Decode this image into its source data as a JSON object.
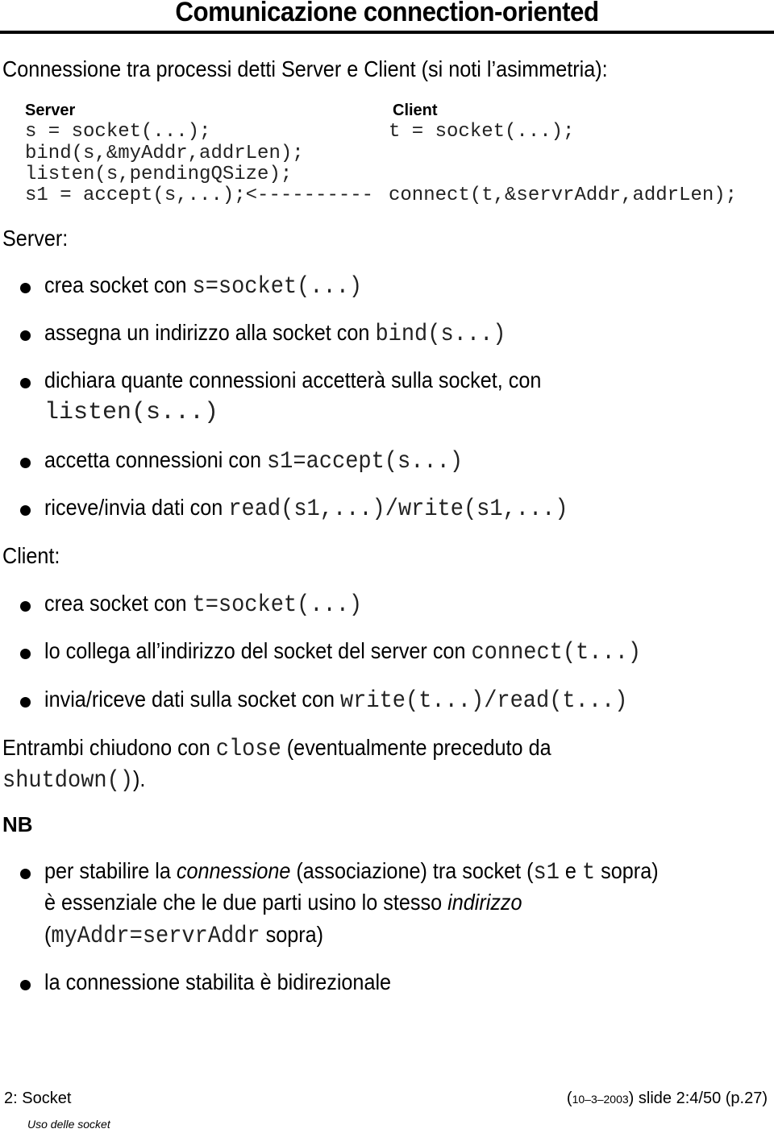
{
  "header": {
    "title": "Comunicazione connection-oriented"
  },
  "intro": "Connessione tra processi detti Server e Client (si noti l’asimmetria):",
  "code_block": {
    "server_heading": "Server",
    "client_heading": "Client",
    "server_lines": [
      "s = socket(...);",
      "bind(s,&myAddr,addrLen);",
      "listen(s,pendingQSize);",
      "s1 = accept(s,...);<----------"
    ],
    "client_lines": [
      "t = socket(...);",
      "",
      "",
      "connect(t,&servrAddr,addrLen);"
    ]
  },
  "server_section": {
    "heading": "Server:",
    "bullets": [
      {
        "text": "crea socket con ",
        "code": "s=socket(...)"
      },
      {
        "text": "assegna un indirizzo alla socket con ",
        "code": "bind(s...)"
      },
      {
        "text": "dichiara quante connessioni accetterà sulla socket, con",
        "code_line2": "listen(s...)"
      },
      {
        "text": "accetta connessioni con ",
        "code": "s1=accept(s...)"
      },
      {
        "text": "riceve/invia dati con ",
        "code": "read(s1,...)/write(s1,...)"
      }
    ]
  },
  "client_section": {
    "heading": "Client:",
    "bullets": [
      {
        "text": "crea socket con ",
        "code": "t=socket(...)"
      },
      {
        "text": "lo collega all’indirizzo del socket del server con ",
        "code": "connect(t...)"
      },
      {
        "text": "invia/riceve dati sulla socket con ",
        "code": "write(t...)/read(t...)"
      }
    ]
  },
  "closing": {
    "prefix": "Entrambi chiudono con ",
    "code": "close",
    "suffix": " (eventualmente preceduto da",
    "line2_code": "shutdown()",
    "line2_suffix": ")."
  },
  "nb": {
    "heading": "NB",
    "bullet1": {
      "l1_a": "per stabilire la ",
      "l1_em": "connessione",
      "l1_b": " (associazione) tra socket (",
      "l1_code1": "s1",
      "l1_c": " e ",
      "l1_code2": "t",
      "l1_d": " sopra)",
      "l2_a": "è essenziale che le due parti usino lo stesso ",
      "l2_em": "indirizzo",
      "l3_a": "(",
      "l3_code": "myAddr=servrAddr",
      "l3_b": " sopra)"
    },
    "bullet2": "la connessione stabilita è bidirezionale"
  },
  "footer": {
    "left": "2: Socket",
    "subtitle": "Uso delle socket",
    "date": "10–3–2003",
    "slide": "slide 2:4/50 (p.27)"
  }
}
